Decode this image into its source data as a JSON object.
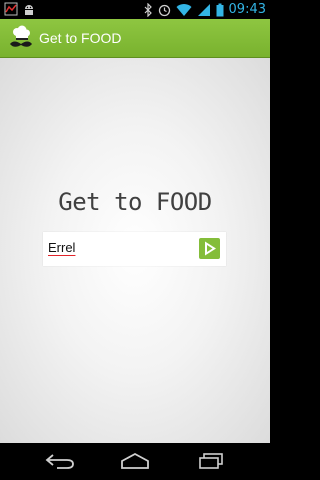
{
  "status_bar": {
    "time": "09:43",
    "icons": [
      "notification-icon",
      "android-icon",
      "bluetooth-icon",
      "alarm-icon",
      "wifi-icon",
      "signal-icon",
      "battery-icon"
    ],
    "time_color": "#33b5e5"
  },
  "action_bar": {
    "title": "Get to FOOD",
    "icon": "chef-hat-mustache-icon",
    "color": "#84bd3a"
  },
  "main": {
    "heading": "Get to FOOD",
    "input": {
      "value": "Errel",
      "placeholder": ""
    },
    "go_button": {
      "icon": "play-arrow-icon",
      "color": "#84bd3a"
    }
  },
  "nav_bar": {
    "buttons": [
      "back-icon",
      "home-icon",
      "recent-apps-icon"
    ]
  }
}
